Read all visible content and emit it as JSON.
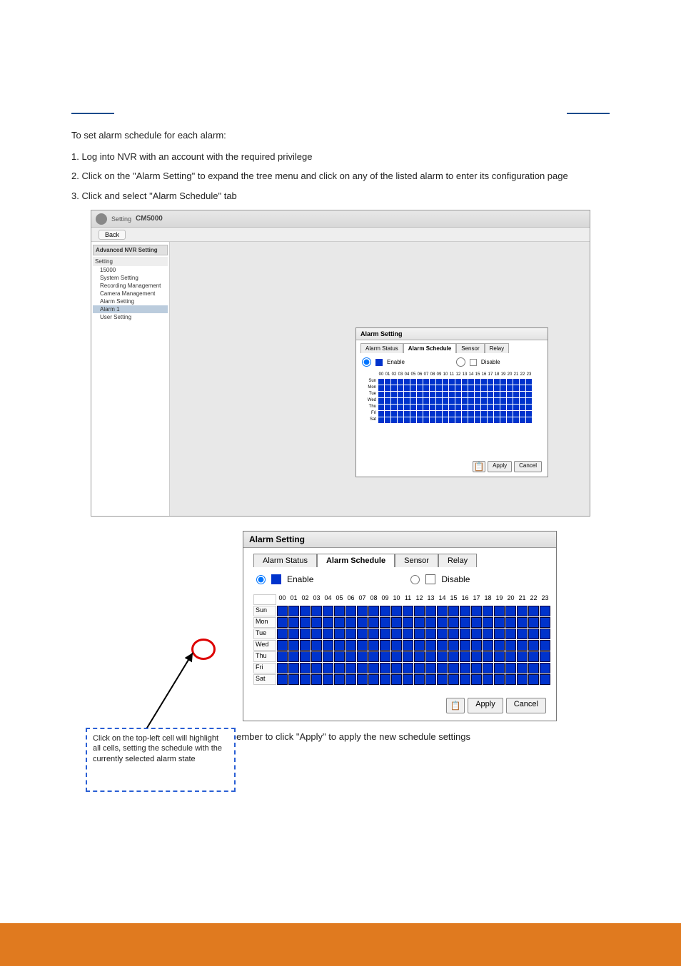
{
  "intro": "To set alarm schedule for each alarm:",
  "steps": {
    "s1": "1. Log into NVR with an account with the required privilege",
    "s2": "2. Click on the \"Alarm Setting\" to expand the tree menu and click on any of the listed alarm to enter its configuration page",
    "s3": "3. Click and select \"Alarm Schedule\" tab"
  },
  "app": {
    "brand": "CM5000",
    "back": "Back",
    "side_header": "Advanced NVR Setting",
    "side_section": "Setting",
    "tree": {
      "root": "15000",
      "items": [
        "System Setting",
        "Recording Management",
        "Camera Management",
        "Alarm Setting",
        "Alarm 1",
        "User Setting"
      ]
    }
  },
  "panel": {
    "title": "Alarm Setting",
    "tabs": [
      "Alarm Status",
      "Alarm Schedule",
      "Sensor",
      "Relay"
    ],
    "enable": "Enable",
    "disable": "Disable",
    "apply": "Apply",
    "cancel": "Cancel"
  },
  "chart_data": {
    "type": "table",
    "hours": [
      "00",
      "01",
      "02",
      "03",
      "04",
      "05",
      "06",
      "07",
      "08",
      "09",
      "10",
      "11",
      "12",
      "13",
      "14",
      "15",
      "16",
      "17",
      "18",
      "19",
      "20",
      "21",
      "22",
      "23"
    ],
    "days": [
      "Sun",
      "Mon",
      "Tue",
      "Wed",
      "Thu",
      "Fri",
      "Sat"
    ],
    "all_enabled": true
  },
  "callout": "Click on the top-left cell will highlight all cells, setting the schedule with the currently selected alarm state",
  "note": "* Remember to click \"Apply\" to apply the new schedule settings"
}
